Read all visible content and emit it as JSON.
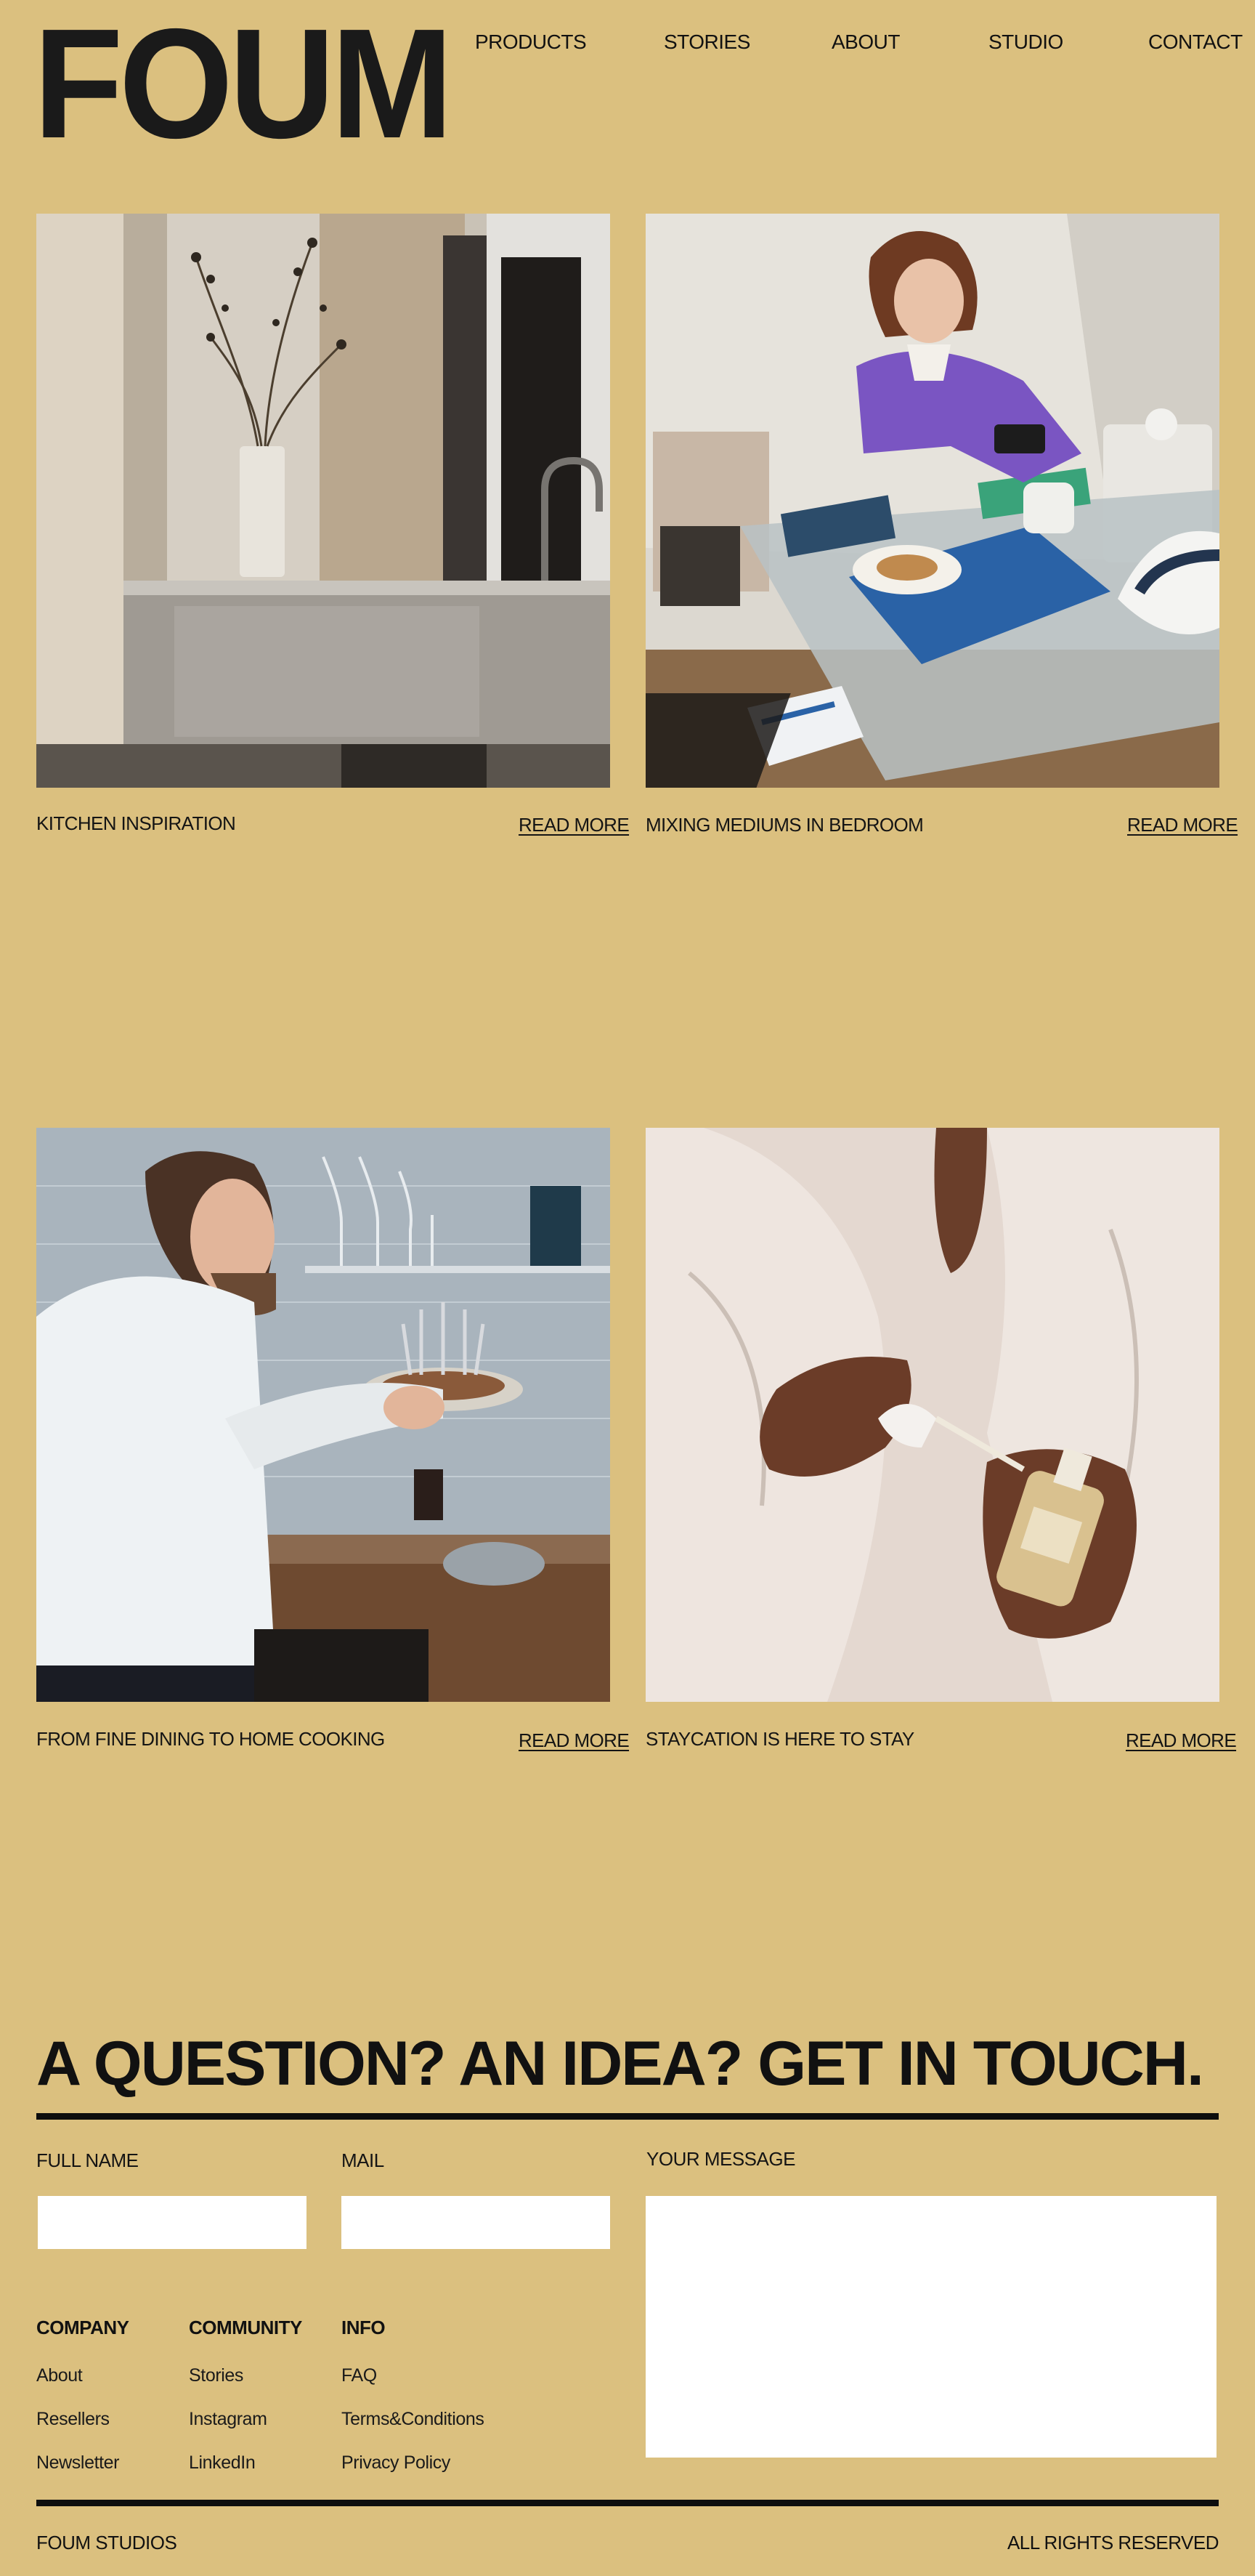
{
  "brand": {
    "logo": "FOUM"
  },
  "nav": [
    "PRODUCTS",
    "STORIES",
    "ABOUT",
    "STUDIO",
    "CONTACT"
  ],
  "stories": [
    {
      "title": "KITCHEN INSPIRATION",
      "cta": "READ MORE"
    },
    {
      "title": "MIXING MEDIUMS IN BEDROOM",
      "cta": "READ MORE"
    },
    {
      "title": "FROM FINE DINING TO HOME COOKING",
      "cta": "READ MORE"
    },
    {
      "title": "STAYCATION IS HERE TO STAY",
      "cta": "READ MORE"
    }
  ],
  "contact": {
    "heading": "A QUESTION? AN IDEA? GET IN TOUCH.",
    "full_name_label": "FULL NAME",
    "full_name_value": "",
    "mail_label": "MAIL",
    "mail_value": "",
    "message_label": "YOUR MESSAGE",
    "message_value": ""
  },
  "footer": {
    "columns": [
      {
        "heading": "COMPANY",
        "links": [
          "About",
          "Resellers",
          "Newsletter"
        ]
      },
      {
        "heading": "COMMUNITY",
        "links": [
          "Stories",
          "Instagram",
          "LinkedIn"
        ]
      },
      {
        "heading": "INFO",
        "links": [
          "FAQ",
          "Terms&Conditions",
          "Privacy Policy"
        ]
      }
    ],
    "studio": "FOUM STUDIOS",
    "rights": "ALL RIGHTS RESERVED"
  },
  "colors": {
    "background": "#DBC07F",
    "text": "#141414",
    "rule": "#0D0D0D",
    "field": "#FFFFFF"
  }
}
